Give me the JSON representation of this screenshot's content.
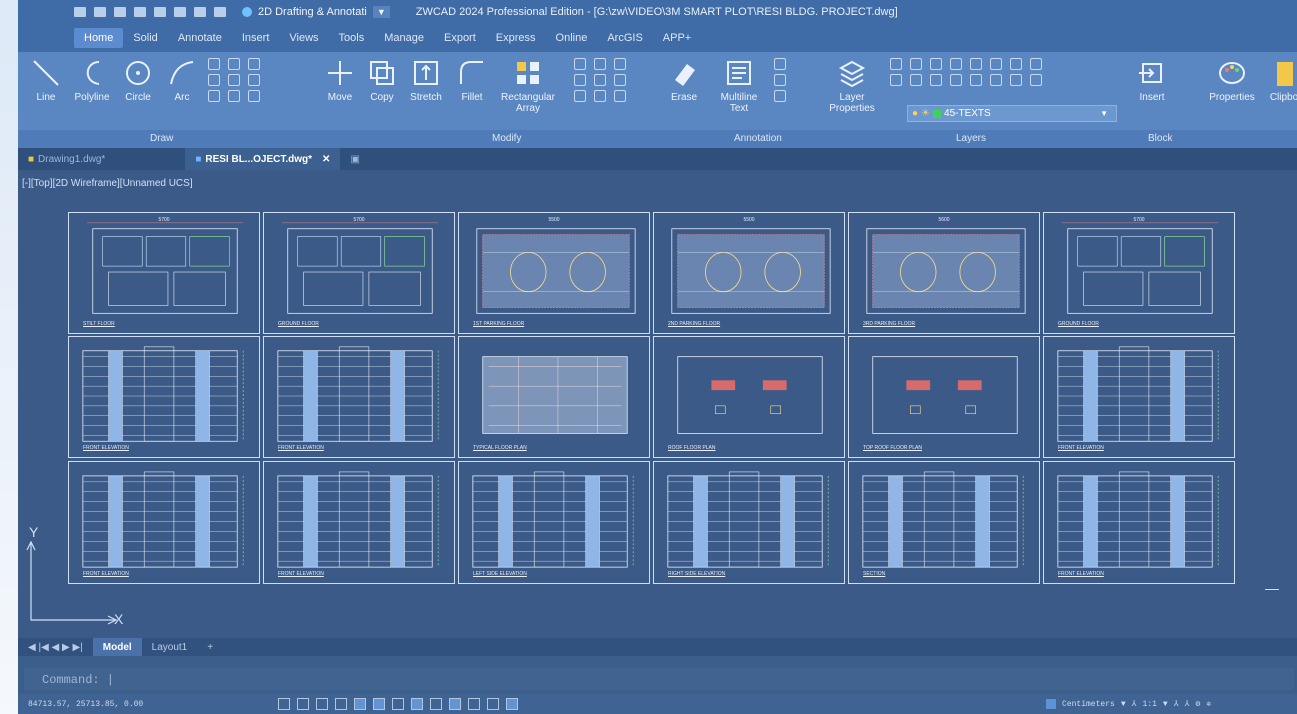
{
  "title_bar": {
    "workspace": "2D Drafting & Annotati",
    "app_title": "ZWCAD 2024 Professional Edition - [G:\\zw\\VIDEO\\3M SMART PLOT\\RESI BLDG. PROJECT.dwg]"
  },
  "menu_tabs": [
    "Home",
    "Solid",
    "Annotate",
    "Insert",
    "Views",
    "Tools",
    "Manage",
    "Export",
    "Express",
    "Online",
    "ArcGIS",
    "APP+"
  ],
  "ribbon": {
    "draw": {
      "line": "Line",
      "polyline": "Polyline",
      "circle": "Circle",
      "arc": "Arc"
    },
    "modify": {
      "move": "Move",
      "copy": "Copy",
      "stretch": "Stretch",
      "fillet": "Fillet",
      "rect_array": "Rectangular Array",
      "erase": "Erase"
    },
    "annotation": {
      "mtext": "Multiline Text"
    },
    "layers": {
      "layer_props": "Layer Properties",
      "current_layer": "45-TEXTS"
    },
    "block": {
      "insert": "Insert"
    },
    "properties": {
      "label": "Properties"
    },
    "clipboard": {
      "label": "Clipbo"
    },
    "panel_labels": {
      "draw": "Draw",
      "modify": "Modify",
      "annotation": "Annotation",
      "layers": "Layers",
      "block": "Block"
    }
  },
  "doc_tabs": [
    "Drawing1.dwg*",
    "RESI BL...OJECT.dwg*"
  ],
  "viewport_label": "[-][Top][2D Wireframe][Unnamed UCS]",
  "sheets": {
    "row1": [
      "STILT FLOOR",
      "GROUND FLOOR",
      "1ST PARKING FLOOR",
      "2ND PARKING FLOOR",
      "3RD PARKING FLOOR",
      "GROUND FLOOR"
    ],
    "row2": [
      "FRONT ELEVATION",
      "FRONT ELEVATION",
      "TYPICAL FLOOR PLAN",
      "ROOF FLOOR PLAN",
      "TOP ROOF FLOOR PLAN",
      "FRONT ELEVATION"
    ],
    "row3": [
      "FRONT ELEVATION",
      "FRONT ELEVATION",
      "LEFT SIDE ELEVATION",
      "RIGHT SIDE ELEVATION",
      "SECTION",
      "FRONT ELEVATION"
    ],
    "dims": [
      "5700",
      "5700",
      "5500",
      "5500",
      "5600",
      "5700"
    ]
  },
  "ucs": {
    "y": "Y",
    "x": "X"
  },
  "layout_tabs": [
    "Model",
    "Layout1",
    "+"
  ],
  "command": {
    "prompt": "Command: |"
  },
  "status_bar": {
    "coords": "84713.57, 25713.85, 0.00",
    "units": "Centimeters",
    "scale": "1:1"
  },
  "colors": {
    "accent": "#5c8bd0",
    "canvas": "#3b5a87",
    "ribbon": "#5a86c2"
  }
}
